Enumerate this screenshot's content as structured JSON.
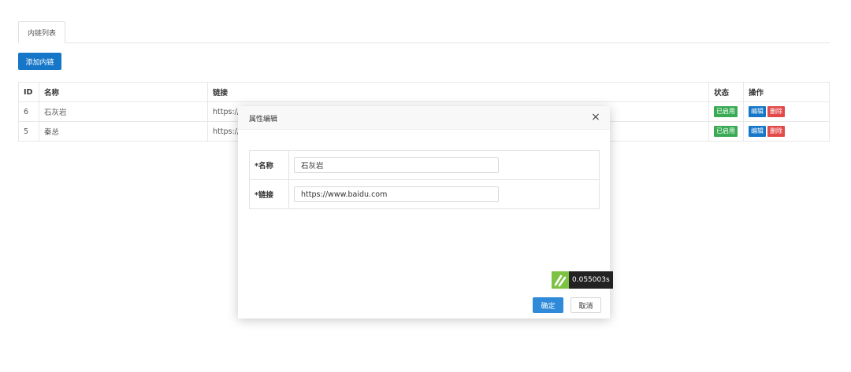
{
  "tabs": [
    {
      "label": "内链列表"
    }
  ],
  "toolbar": {
    "add_label": "添加内链"
  },
  "table": {
    "headers": {
      "id": "ID",
      "name": "名称",
      "link": "链接",
      "status": "状态",
      "ops": "操作"
    },
    "rows": [
      {
        "id": "6",
        "name": "石灰岩",
        "link": "https://",
        "status": "已启用",
        "edit": "编辑",
        "delete": "删除"
      },
      {
        "id": "5",
        "name": "秦总",
        "link": "https://",
        "status": "已启用",
        "edit": "编辑",
        "delete": "删除"
      }
    ]
  },
  "modal": {
    "title": "属性编辑",
    "close_glyph": "×",
    "fields": [
      {
        "label": "*名称",
        "value": "石灰岩"
      },
      {
        "label": "*链接",
        "value": "https://www.baidu.com"
      }
    ],
    "timer": "0.055003s",
    "ok_label": "确定",
    "cancel_label": "取消"
  },
  "colors": {
    "primary": "#1677c8",
    "success": "#3aaa55",
    "danger": "#e24a4a",
    "timer_logo": "#7dc242"
  }
}
